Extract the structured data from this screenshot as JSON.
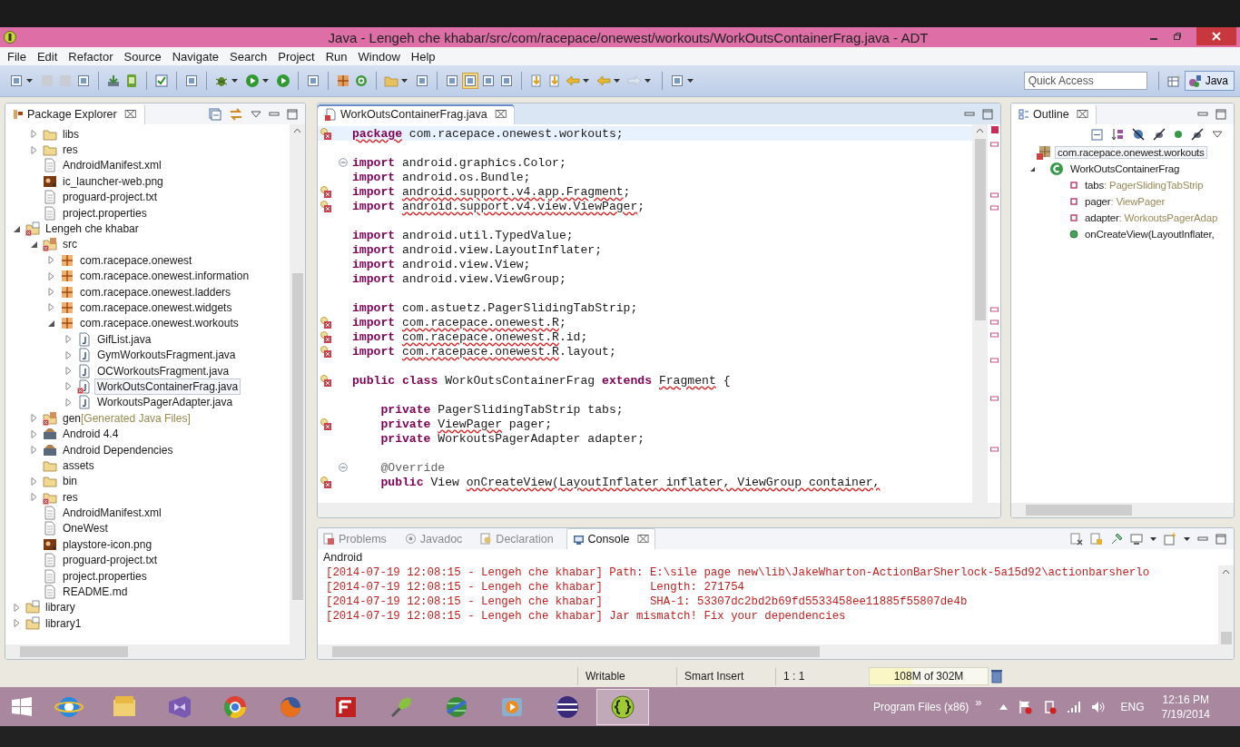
{
  "window": {
    "title": "Java - Lengeh che khabar/src/com/racepace/onewest/workouts/WorkOutsContainerFrag.java - ADT"
  },
  "menu": [
    "File",
    "Edit",
    "Refactor",
    "Source",
    "Navigate",
    "Search",
    "Project",
    "Run",
    "Window",
    "Help"
  ],
  "quick_access": {
    "placeholder": "Quick Access"
  },
  "perspective": {
    "label": "Java",
    "selected": true
  },
  "package_explorer": {
    "title": "Package Explorer",
    "close": "⌧",
    "tree": {
      "continued_children": [
        {
          "label": "libs",
          "kind": "folder",
          "expanded": false,
          "selected": false
        },
        {
          "label": "res",
          "kind": "folder",
          "expanded": false,
          "selected": false
        },
        {
          "label": "AndroidManifest.xml",
          "kind": "xml",
          "selected": false
        },
        {
          "label": "ic_launcher-web.png",
          "kind": "image",
          "selected": false
        },
        {
          "label": "proguard-project.txt",
          "kind": "text",
          "selected": false
        },
        {
          "label": "project.properties",
          "kind": "text",
          "selected": false
        }
      ],
      "roots": [
        {
          "label": "Lengeh che khabar",
          "kind": "project",
          "expanded": true,
          "selected": false,
          "children": [
            {
              "label": "src",
              "kind": "source",
              "expanded": true,
              "selected": false,
              "children": [
                {
                  "label": "com.racepace.onewest",
                  "kind": "package",
                  "expanded": false,
                  "selected": false
                },
                {
                  "label": "com.racepace.onewest.information",
                  "kind": "package",
                  "expanded": false,
                  "selected": false
                },
                {
                  "label": "com.racepace.onewest.ladders",
                  "kind": "package",
                  "expanded": false,
                  "selected": false
                },
                {
                  "label": "com.racepace.onewest.widgets",
                  "kind": "package",
                  "expanded": false,
                  "selected": false
                },
                {
                  "label": "com.racepace.onewest.workouts",
                  "kind": "package",
                  "expanded": true,
                  "selected": false,
                  "children": [
                    {
                      "label": "GifList.java",
                      "kind": "java",
                      "expanded": false,
                      "selected": false
                    },
                    {
                      "label": "GymWorkoutsFragment.java",
                      "kind": "java",
                      "expanded": false,
                      "selected": false
                    },
                    {
                      "label": "OCWorkoutsFragment.java",
                      "kind": "java",
                      "expanded": false,
                      "selected": false
                    },
                    {
                      "label": "WorkOutsContainerFrag.java",
                      "kind": "java_error",
                      "expanded": false,
                      "selected": true
                    },
                    {
                      "label": "WorkoutsPagerAdapter.java",
                      "kind": "java",
                      "expanded": false,
                      "selected": false
                    }
                  ]
                }
              ]
            },
            {
              "label": "gen",
              "decoration": "[Generated Java Files]",
              "kind": "source",
              "expanded": false,
              "selected": false
            },
            {
              "label": "Android 4.4",
              "kind": "library",
              "expanded": false,
              "selected": false
            },
            {
              "label": "Android Dependencies",
              "kind": "library",
              "expanded": false,
              "selected": false
            },
            {
              "label": "assets",
              "kind": "folder",
              "selected": false
            },
            {
              "label": "bin",
              "kind": "folder",
              "expanded": false,
              "selected": false
            },
            {
              "label": "res",
              "kind": "folder_error",
              "expanded": false,
              "selected": false
            },
            {
              "label": "AndroidManifest.xml",
              "kind": "xml",
              "selected": false
            },
            {
              "label": "OneWest",
              "kind": "text",
              "selected": false
            },
            {
              "label": "playstore-icon.png",
              "kind": "image",
              "selected": false
            },
            {
              "label": "proguard-project.txt",
              "kind": "text",
              "selected": false
            },
            {
              "label": "project.properties",
              "kind": "text",
              "selected": false
            },
            {
              "label": "README.md",
              "kind": "text",
              "selected": false
            }
          ]
        },
        {
          "label": "library",
          "kind": "project_plain",
          "expanded": false,
          "selected": false
        },
        {
          "label": "library1",
          "kind": "project_plain",
          "expanded": false,
          "selected": false
        }
      ]
    }
  },
  "editor": {
    "tab": {
      "label": "WorkOutsContainerFrag.java",
      "close": "⌧",
      "selected": true
    },
    "lines": [
      {
        "error": true,
        "fold": false,
        "current": true,
        "parts": [
          {
            "kind": "keyword_error",
            "text": "package"
          },
          {
            "kind": "plain",
            "text": " com.racepace.onewest.workouts;"
          }
        ]
      },
      {
        "error": false,
        "fold": false,
        "current": false
      },
      {
        "error": false,
        "fold": true,
        "current": false,
        "parts": [
          {
            "kind": "keyword",
            "text": "import"
          },
          {
            "kind": "plain",
            "text": " android.graphics.Color;"
          }
        ]
      },
      {
        "error": false,
        "fold": false,
        "current": false,
        "parts": [
          {
            "kind": "keyword",
            "text": "import"
          },
          {
            "kind": "plain",
            "text": " android.os.Bundle;"
          }
        ]
      },
      {
        "error": true,
        "fold": false,
        "current": false,
        "parts": [
          {
            "kind": "keyword",
            "text": "import "
          },
          {
            "kind": "error",
            "text": "android.support.v4.app.Fragment"
          },
          {
            "kind": "plain",
            "text": ";"
          }
        ]
      },
      {
        "error": true,
        "fold": false,
        "current": false,
        "parts": [
          {
            "kind": "keyword",
            "text": "import "
          },
          {
            "kind": "error",
            "text": "android.support.v4.view.ViewPager"
          },
          {
            "kind": "plain",
            "text": ";"
          }
        ]
      },
      {
        "error": false,
        "fold": false,
        "current": false
      },
      {
        "error": false,
        "fold": false,
        "current": false,
        "parts": [
          {
            "kind": "keyword",
            "text": "import"
          },
          {
            "kind": "plain",
            "text": " android.util.TypedValue;"
          }
        ]
      },
      {
        "error": false,
        "fold": false,
        "current": false,
        "parts": [
          {
            "kind": "keyword",
            "text": "import"
          },
          {
            "kind": "plain",
            "text": " android.view.LayoutInflater;"
          }
        ]
      },
      {
        "error": false,
        "fold": false,
        "current": false,
        "parts": [
          {
            "kind": "keyword",
            "text": "import"
          },
          {
            "kind": "plain",
            "text": " android.view.View;"
          }
        ]
      },
      {
        "error": false,
        "fold": false,
        "current": false,
        "parts": [
          {
            "kind": "keyword",
            "text": "import"
          },
          {
            "kind": "plain",
            "text": " android.view.ViewGroup;"
          }
        ]
      },
      {
        "error": false,
        "fold": false,
        "current": false
      },
      {
        "error": false,
        "fold": false,
        "current": false,
        "parts": [
          {
            "kind": "keyword",
            "text": "import"
          },
          {
            "kind": "plain",
            "text": " com.astuetz.PagerSlidingTabStrip;"
          }
        ]
      },
      {
        "error": true,
        "fold": false,
        "current": false,
        "parts": [
          {
            "kind": "keyword",
            "text": "import "
          },
          {
            "kind": "error",
            "text": "com.racepace.onewest.R"
          },
          {
            "kind": "plain",
            "text": ";"
          }
        ]
      },
      {
        "error": true,
        "fold": false,
        "current": false,
        "parts": [
          {
            "kind": "keyword",
            "text": "import "
          },
          {
            "kind": "error",
            "text": "com.racepace.onewest.R"
          },
          {
            "kind": "plain",
            "text": ".id;"
          }
        ]
      },
      {
        "error": true,
        "fold": false,
        "current": false,
        "parts": [
          {
            "kind": "keyword",
            "text": "import "
          },
          {
            "kind": "error",
            "text": "com.racepace.onewest.R"
          },
          {
            "kind": "plain",
            "text": ".layout;"
          }
        ]
      },
      {
        "error": false,
        "fold": false,
        "current": false
      },
      {
        "error": true,
        "fold": false,
        "current": false,
        "parts": [
          {
            "kind": "keyword",
            "text": "public class"
          },
          {
            "kind": "plain",
            "text": " WorkOutsContainerFrag "
          },
          {
            "kind": "keyword",
            "text": "extends "
          },
          {
            "kind": "error",
            "text": "Fragment"
          },
          {
            "kind": "plain",
            "text": " {"
          }
        ]
      },
      {
        "error": false,
        "fold": false,
        "current": false
      },
      {
        "error": false,
        "fold": false,
        "current": false,
        "parts": [
          {
            "kind": "keyword",
            "text": "    private"
          },
          {
            "kind": "plain",
            "text": " PagerSlidingTabStrip tabs;"
          }
        ]
      },
      {
        "error": true,
        "fold": false,
        "current": false,
        "parts": [
          {
            "kind": "keyword",
            "text": "    private "
          },
          {
            "kind": "error",
            "text": "ViewPager"
          },
          {
            "kind": "plain",
            "text": " pager;"
          }
        ]
      },
      {
        "error": false,
        "fold": false,
        "current": false,
        "parts": [
          {
            "kind": "keyword",
            "text": "    private"
          },
          {
            "kind": "plain",
            "text": " WorkoutsPagerAdapter adapter;"
          }
        ]
      },
      {
        "error": false,
        "fold": false,
        "current": false
      },
      {
        "error": false,
        "fold": true,
        "current": false,
        "parts": [
          {
            "kind": "annotation",
            "text": "    @Override"
          }
        ]
      },
      {
        "error": true,
        "fold": false,
        "current": false,
        "parts": [
          {
            "kind": "keyword",
            "text": "    public"
          },
          {
            "kind": "plain",
            "text": " View "
          },
          {
            "kind": "error",
            "text": "onCreateView(LayoutInflater inflater, ViewGroup container,"
          }
        ]
      }
    ]
  },
  "outline": {
    "title": "Outline",
    "close": "⌧",
    "items": [
      {
        "kind": "package",
        "name": "com.racepace.onewest.workouts",
        "selected": true
      },
      {
        "kind": "class",
        "name": "WorkOutsContainerFrag",
        "expanded": true,
        "selected": false,
        "children": [
          {
            "kind": "field",
            "name": "tabs",
            "type": ": PagerSlidingTabStrip",
            "selected": false
          },
          {
            "kind": "field",
            "name": "pager",
            "type": ": ViewPager",
            "selected": false
          },
          {
            "kind": "field",
            "name": "adapter",
            "type": ": WorkoutsPagerAdap",
            "selected": false
          },
          {
            "kind": "method",
            "name": "onCreateView(LayoutInflater,",
            "selected": false
          }
        ]
      }
    ]
  },
  "bottom": {
    "tabs": [
      {
        "label": "Problems",
        "kind": "problems",
        "selected": false
      },
      {
        "label": "Javadoc",
        "kind": "javadoc",
        "selected": false
      },
      {
        "label": "Declaration",
        "kind": "declaration",
        "selected": false
      },
      {
        "label": "Console",
        "kind": "console",
        "selected": true,
        "close": "⌧"
      }
    ],
    "console_name": "Android",
    "lines": [
      "[2014-07-19 12:08:15 - Lengeh che khabar] Path: E:\\sile page new\\lib\\JakeWharton-ActionBarSherlock-5a15d92\\actionbarsherlo",
      "[2014-07-19 12:08:15 - Lengeh che khabar]       Length: 271754",
      "[2014-07-19 12:08:15 - Lengeh che khabar]       SHA-1: 53307dc2bd2b69fd5533458ee11885f55807de4b",
      "[2014-07-19 12:08:15 - Lengeh che khabar] Jar mismatch! Fix your dependencies"
    ]
  },
  "status_bar": {
    "writable": "Writable",
    "insert_mode": "Smart Insert",
    "position": "1 : 1",
    "heap": {
      "label": "108M of 302M",
      "level": 0.36
    }
  },
  "taskbar": {
    "apps": [
      {
        "kind": "ie",
        "selected": false
      },
      {
        "kind": "explorer",
        "selected": false
      },
      {
        "kind": "vs",
        "selected": false
      },
      {
        "kind": "chrome",
        "selected": false
      },
      {
        "kind": "firefox",
        "selected": false
      },
      {
        "kind": "filezilla",
        "selected": false
      },
      {
        "kind": "satellite",
        "selected": false
      },
      {
        "kind": "globe",
        "selected": false
      },
      {
        "kind": "media",
        "selected": false
      },
      {
        "kind": "eclipse",
        "selected": false
      },
      {
        "kind": "brackets",
        "selected": true
      }
    ],
    "toolbar_label": "Program Files (x86)",
    "more": "»",
    "language": "ENG",
    "time": "12:16 PM",
    "date": "7/19/2014"
  }
}
